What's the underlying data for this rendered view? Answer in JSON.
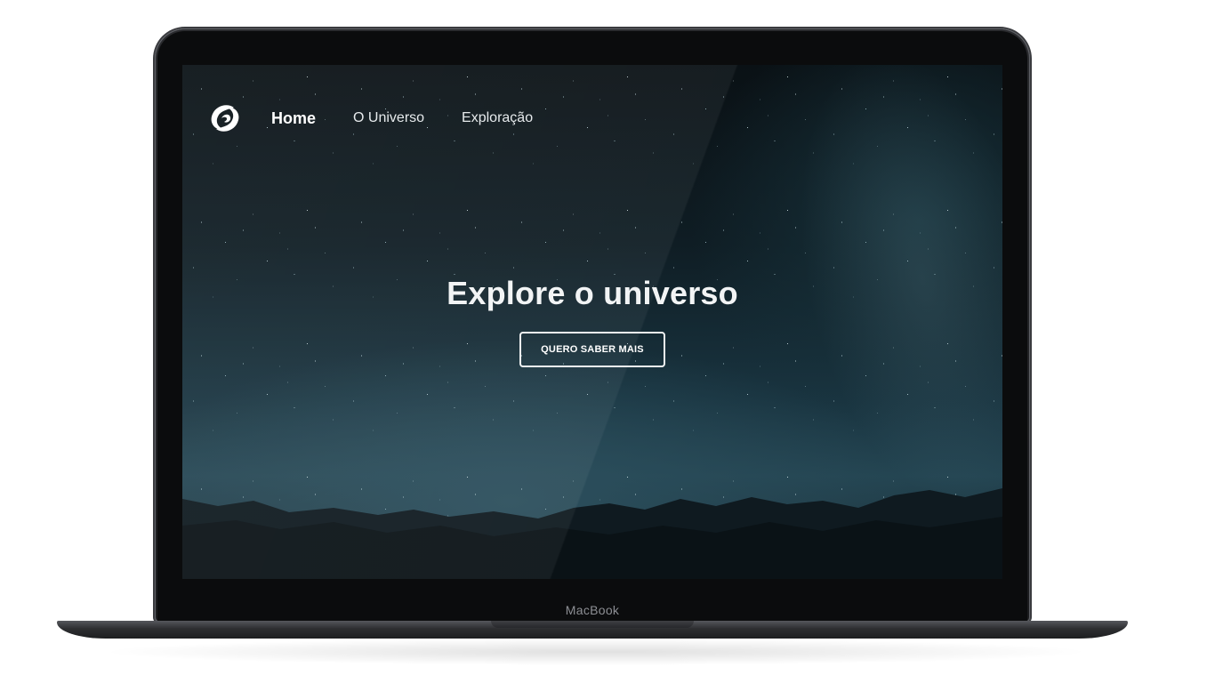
{
  "device": {
    "brand_label": "MacBook"
  },
  "nav": {
    "logo_icon": "swirl-logo-icon",
    "items": [
      {
        "label": "Home",
        "active": true
      },
      {
        "label": "O Universo",
        "active": false
      },
      {
        "label": "Exploração",
        "active": false
      }
    ]
  },
  "hero": {
    "title": "Explore o universo",
    "cta_label": "QUERO SABER MAIS"
  },
  "colors": {
    "sky_top": "#0a1115",
    "sky_horizon": "#244552",
    "text": "#f2f4f5"
  }
}
